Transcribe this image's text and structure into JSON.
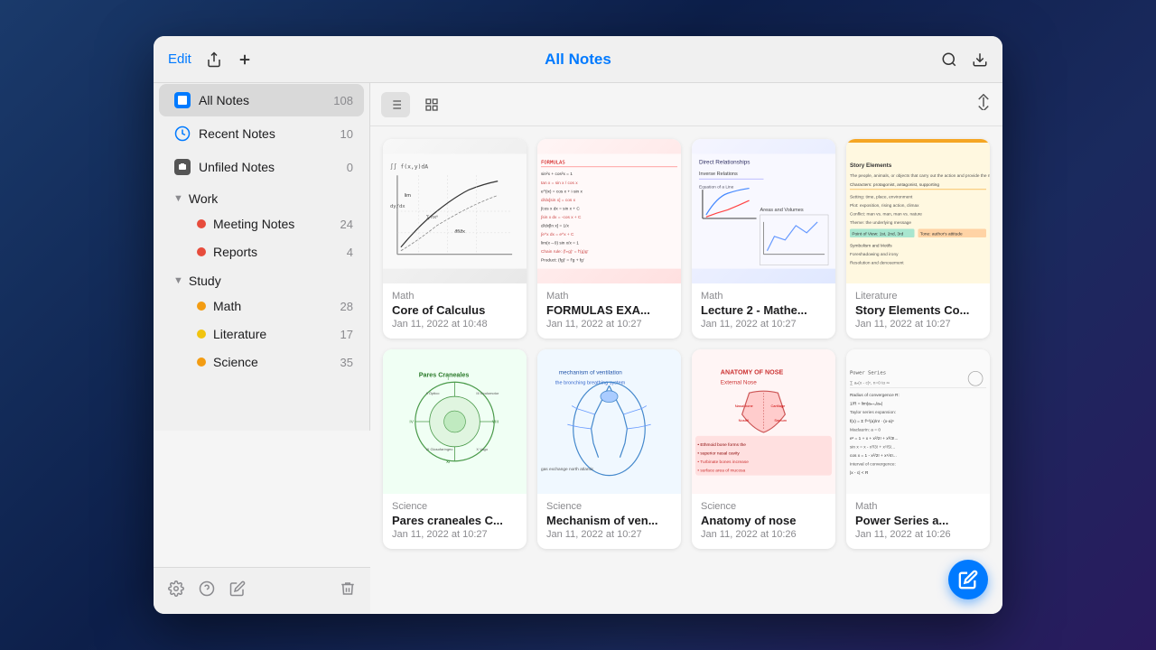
{
  "titleBar": {
    "editLabel": "Edit",
    "title": "All Notes",
    "addLabel": "+",
    "shareLabel": "⬆",
    "searchLabel": "🔍",
    "downloadLabel": "⬇"
  },
  "sidebar": {
    "allNotes": {
      "label": "All Notes",
      "count": "108"
    },
    "recentNotes": {
      "label": "Recent Notes",
      "count": "10"
    },
    "unfiledNotes": {
      "label": "Unfiled Notes",
      "count": "0"
    },
    "work": {
      "label": "Work",
      "children": [
        {
          "label": "Meeting Notes",
          "count": "24",
          "color": "red"
        },
        {
          "label": "Reports",
          "count": "4",
          "color": "red"
        }
      ]
    },
    "study": {
      "label": "Study",
      "children": [
        {
          "label": "Math",
          "count": "28",
          "color": "orange"
        },
        {
          "label": "Literature",
          "count": "17",
          "color": "yellow"
        },
        {
          "label": "Science",
          "count": "35",
          "color": "orange"
        }
      ]
    }
  },
  "toolbar": {
    "listViewLabel": "☰",
    "gridViewLabel": "⊞",
    "sortLabel": "⇅"
  },
  "notes": [
    {
      "category": "Math",
      "title": "Core of Calculus",
      "date": "Jan 11, 2022 at 10:48",
      "thumbType": "math1",
      "thumbIcon": "📐"
    },
    {
      "category": "Math",
      "title": "FORMULAS EXA...",
      "date": "Jan 11, 2022 at 10:27",
      "thumbType": "math2",
      "thumbIcon": "📝"
    },
    {
      "category": "Math",
      "title": "Lecture 2 - Mathe...",
      "date": "Jan 11, 2022 at 10:27",
      "thumbType": "math3",
      "thumbIcon": "📊"
    },
    {
      "category": "Literature",
      "title": "Story Elements Co...",
      "date": "Jan 11, 2022 at 10:27",
      "thumbType": "lit",
      "thumbIcon": "📖"
    },
    {
      "category": "Science",
      "title": "Pares craneales C...",
      "date": "Jan 11, 2022 at 10:27",
      "thumbType": "sci1",
      "thumbIcon": "🧠"
    },
    {
      "category": "Science",
      "title": "Mechanism of ven...",
      "date": "Jan 11, 2022 at 10:27",
      "thumbType": "sci2",
      "thumbIcon": "🫁"
    },
    {
      "category": "Science",
      "title": "Anatomy of nose",
      "date": "Jan 11, 2022 at 10:26",
      "thumbType": "sci3",
      "thumbIcon": "👃"
    },
    {
      "category": "Math",
      "title": "Power Series a...",
      "date": "Jan 11, 2022 at 10:26",
      "thumbType": "sci4",
      "thumbIcon": "∑"
    }
  ],
  "fab": {
    "label": "✏️"
  }
}
